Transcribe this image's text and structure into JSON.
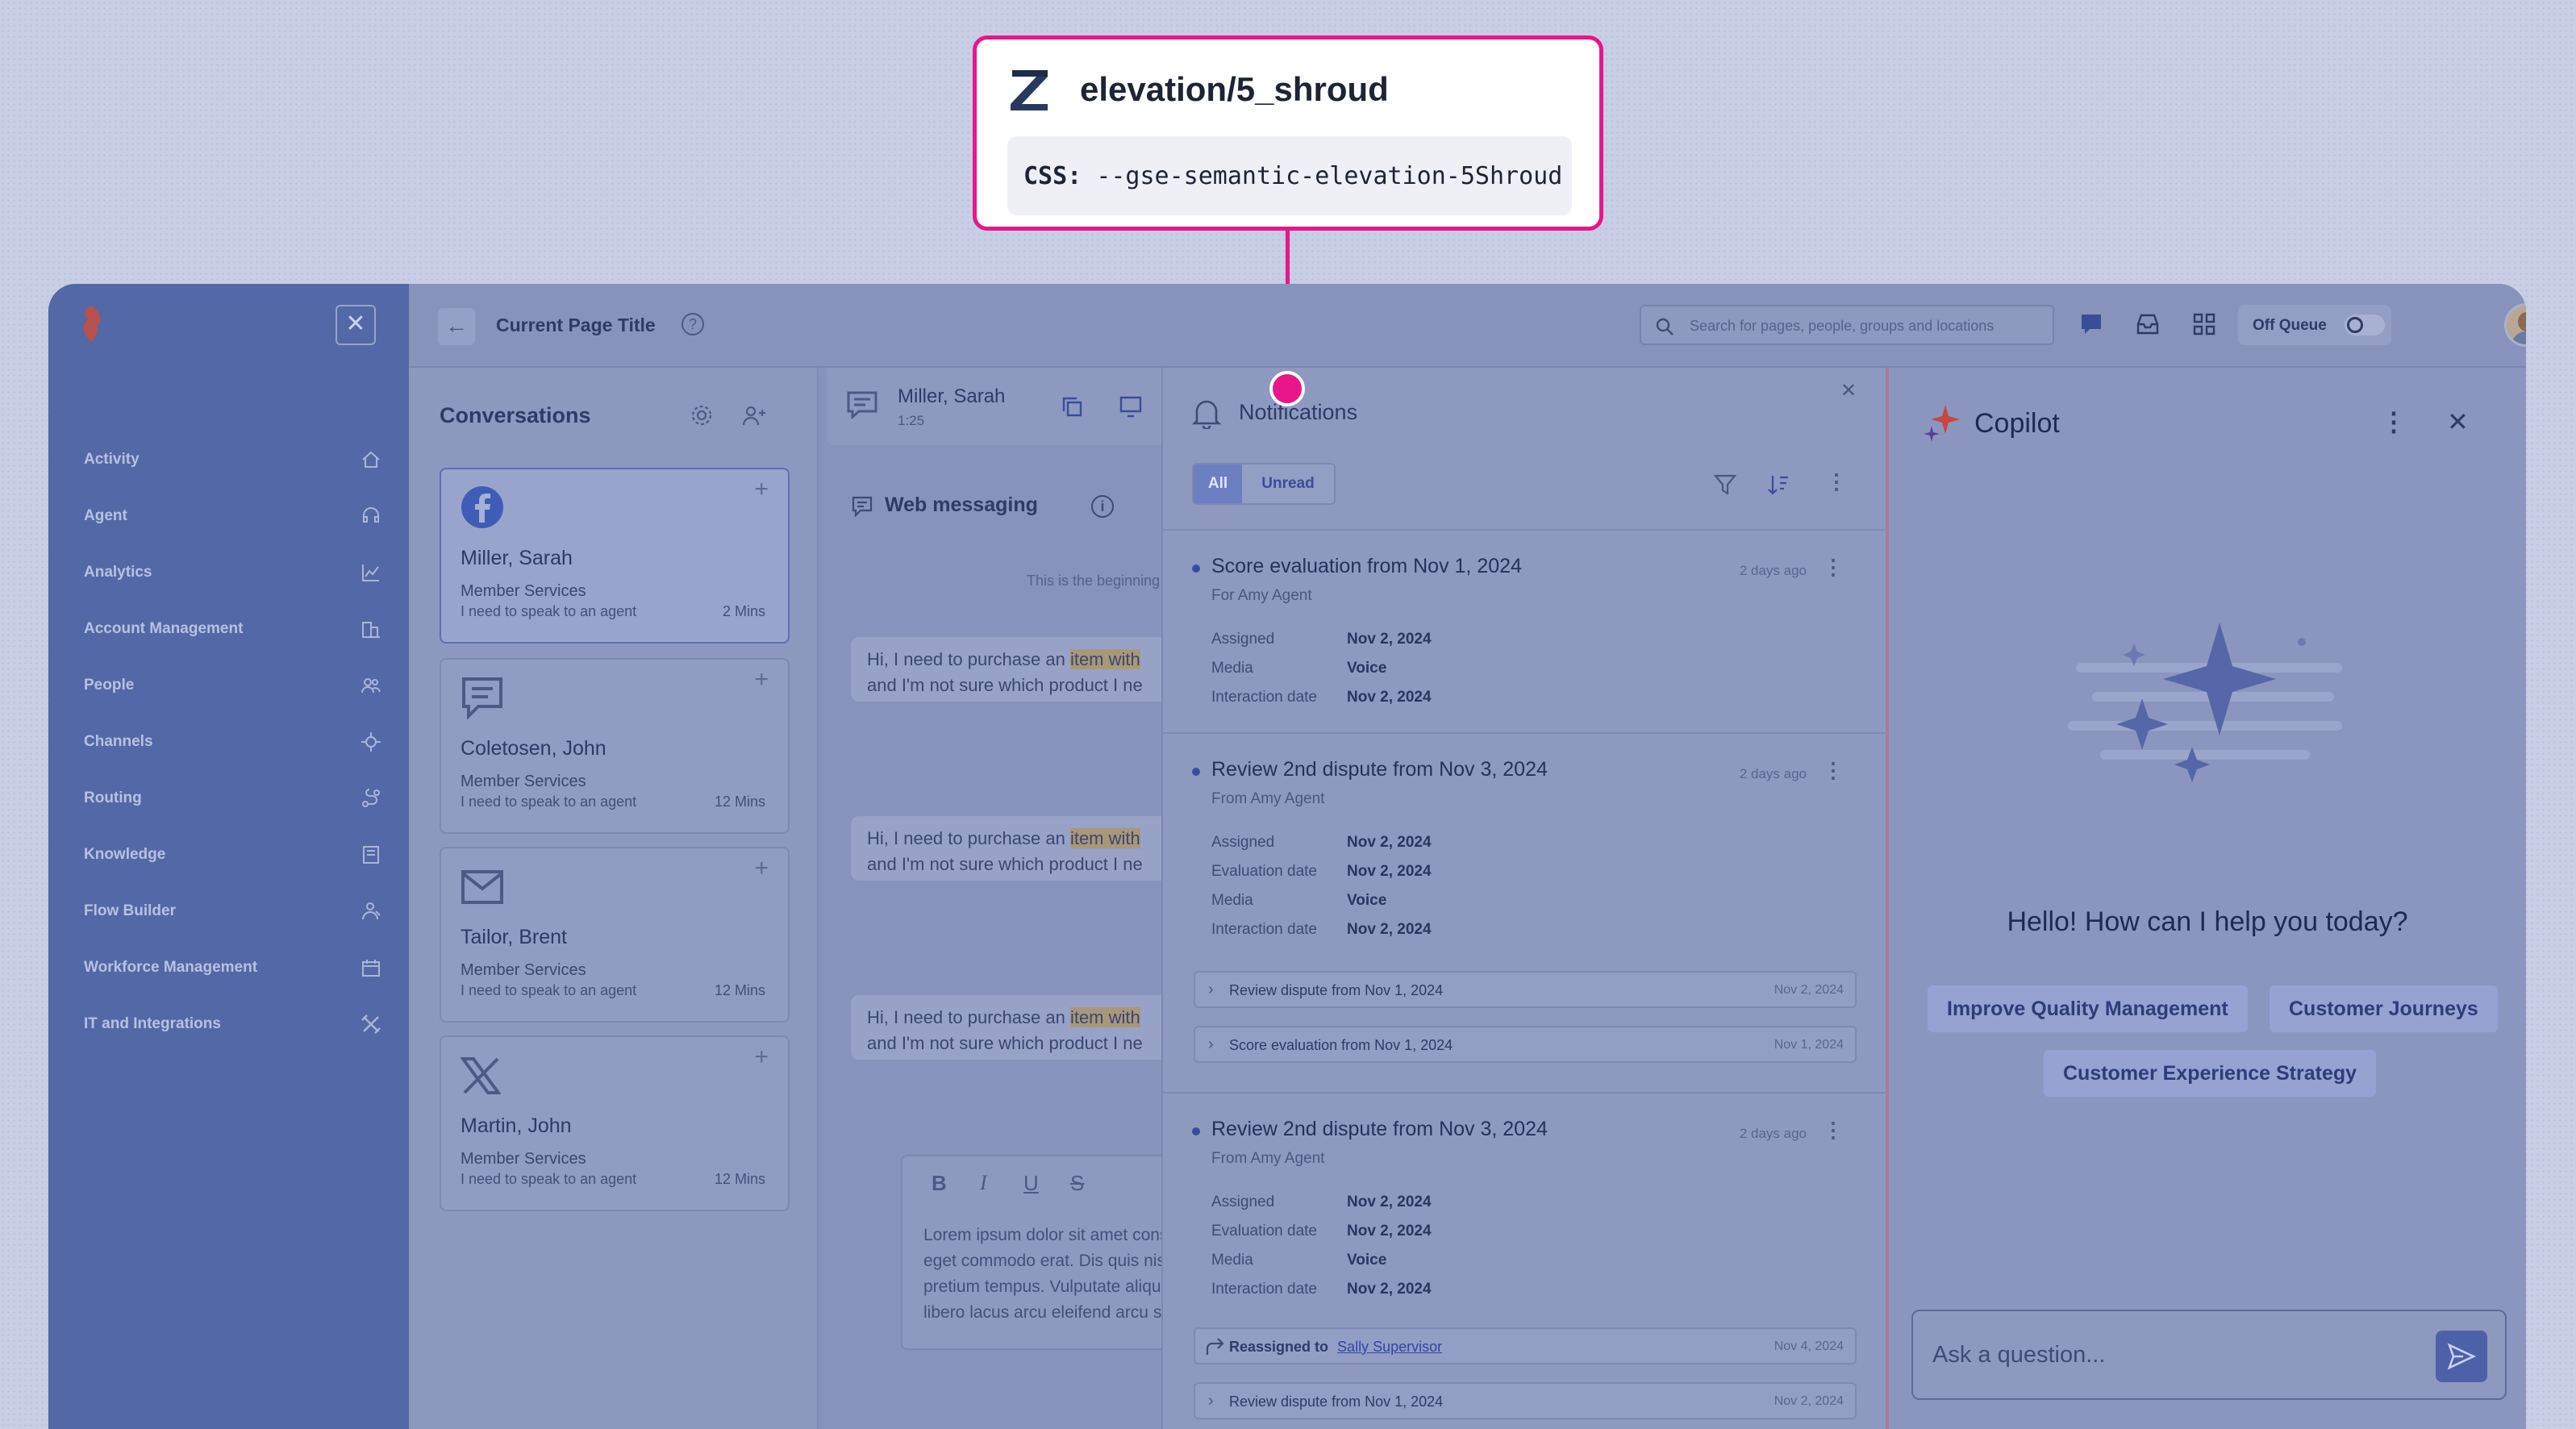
{
  "callout": {
    "title": "elevation/5_shroud",
    "css_label": "CSS:",
    "css_value": "--gse-semantic-elevation-5Shroud"
  },
  "sidebar": {
    "items": [
      {
        "label": "Activity",
        "icon": "home-icon"
      },
      {
        "label": "Agent",
        "icon": "headset-icon"
      },
      {
        "label": "Analytics",
        "icon": "chart-icon"
      },
      {
        "label": "Account Management",
        "icon": "account-icon"
      },
      {
        "label": "People",
        "icon": "people-icon"
      },
      {
        "label": "Channels",
        "icon": "channels-icon"
      },
      {
        "label": "Routing",
        "icon": "routing-icon"
      },
      {
        "label": "Knowledge",
        "icon": "book-icon"
      },
      {
        "label": "Flow Builder",
        "icon": "flow-icon"
      },
      {
        "label": "Workforce Management",
        "icon": "calendar-icon"
      },
      {
        "label": "IT and Integrations",
        "icon": "tools-icon"
      }
    ]
  },
  "topbar": {
    "page_title": "Current Page Title",
    "search_placeholder": "Search for pages, people, groups and locations",
    "queue_label": "Off Queue"
  },
  "conversations": {
    "title": "Conversations",
    "cards": [
      {
        "name": "Miller, Sarah",
        "dept": "Member Services",
        "preview": "I need to speak to an agent",
        "time": "2 Mins",
        "channel": "facebook-icon"
      },
      {
        "name": "Coletosen, John",
        "dept": "Member Services",
        "preview": "I need to speak to an agent",
        "time": "12 Mins",
        "channel": "chat-icon"
      },
      {
        "name": "Tailor, Brent",
        "dept": "Member Services",
        "preview": "I need to speak to an agent",
        "time": "12 Mins",
        "channel": "mail-icon"
      },
      {
        "name": "Martin, John",
        "dept": "Member Services",
        "preview": "I need to speak to an agent",
        "time": "12 Mins",
        "channel": "x-icon"
      }
    ]
  },
  "chat": {
    "contact_name": "Miller, Sarah",
    "contact_time": "1:25",
    "section_title": "Web messaging",
    "beginning_text": "This is the beginning of",
    "messages": [
      {
        "line1_pre": "Hi, I need to purchase an ",
        "line1_hl": "item with",
        "line2": "and I'm not sure which product I ne"
      },
      {
        "line1_pre": "Hi, I need to purchase an ",
        "line1_hl": "item with",
        "line2": "and I'm not sure which product I ne"
      },
      {
        "line1_pre": "Hi, I need to purchase an ",
        "line1_hl": "item with",
        "line2": "and I'm not sure which product I ne"
      }
    ],
    "editor_lines": [
      "Lorem ipsum dolor sit amet consect",
      "eget commodo erat. Dis quis nisl",
      "pretium tempus. Vulputate aliquet c",
      "libero lacus arcu eleifend arcu sed e"
    ]
  },
  "notifications": {
    "title": "Notifications",
    "filters": [
      "All",
      "Unread"
    ],
    "items": [
      {
        "title": "Score evaluation from Nov 1, 2024",
        "from": "For Amy Agent",
        "ago": "2 days ago",
        "fields": [
          {
            "k": "Assigned",
            "v": "Nov 2, 2024"
          },
          {
            "k": "Media",
            "v": "Voice"
          },
          {
            "k": "Interaction date",
            "v": "Nov 2, 2024"
          }
        ]
      },
      {
        "title": "Review 2nd dispute from Nov 3, 2024",
        "from": "From Amy Agent",
        "ago": "2 days ago",
        "fields": [
          {
            "k": "Assigned",
            "v": "Nov 2, 2024"
          },
          {
            "k": "Evaluation date",
            "v": "Nov 2, 2024"
          },
          {
            "k": "Media",
            "v": "Voice"
          },
          {
            "k": "Interaction date",
            "v": "Nov 2, 2024"
          }
        ],
        "subs": [
          {
            "label": "Review dispute from Nov 1, 2024",
            "date": "Nov 2, 2024"
          },
          {
            "label": "Score evaluation from Nov 1, 2024",
            "date": "Nov 1, 2024"
          }
        ]
      },
      {
        "title": "Review 2nd dispute from Nov 3, 2024",
        "from": "From Amy Agent",
        "ago": "2 days ago",
        "fields": [
          {
            "k": "Assigned",
            "v": "Nov 2, 2024"
          },
          {
            "k": "Evaluation date",
            "v": "Nov 2, 2024"
          },
          {
            "k": "Media",
            "v": "Voice"
          },
          {
            "k": "Interaction date",
            "v": "Nov 2, 2024"
          }
        ],
        "reassigned": {
          "label": "Reassigned to",
          "person": "Sally Supervisor",
          "date": "Nov 4, 2024"
        },
        "subs": [
          {
            "label": "Review dispute from Nov 1, 2024",
            "date": "Nov 2, 2024"
          }
        ]
      }
    ]
  },
  "copilot": {
    "title": "Copilot",
    "greeting": "Hello! How can I help you today?",
    "suggestions": [
      "Improve Quality Management",
      "Customer Journeys",
      "Customer Experience Strategy"
    ],
    "input_placeholder": "Ask a question..."
  },
  "colors": {
    "callout_accent": "#e8168a",
    "sidebar": "#5368a6",
    "shroud": "#8491b9"
  }
}
